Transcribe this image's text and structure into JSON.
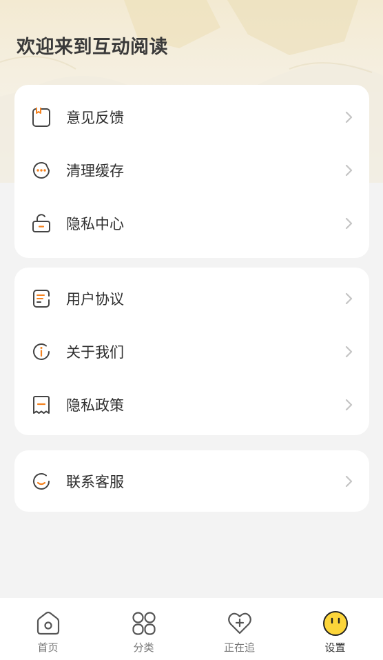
{
  "header": {
    "title": "欢迎来到互动阅读"
  },
  "groups": [
    {
      "items": [
        {
          "label": "意见反馈",
          "icon": "feedback-bookmark-icon"
        },
        {
          "label": "清理缓存",
          "icon": "chat-dots-icon"
        },
        {
          "label": "隐私中心",
          "icon": "lock-icon"
        }
      ]
    },
    {
      "items": [
        {
          "label": "用户协议",
          "icon": "document-icon"
        },
        {
          "label": "关于我们",
          "icon": "info-icon"
        },
        {
          "label": "隐私政策",
          "icon": "receipt-icon"
        }
      ]
    },
    {
      "items": [
        {
          "label": "联系客服",
          "icon": "smile-icon"
        }
      ]
    }
  ],
  "tabbar": {
    "items": [
      {
        "label": "首页",
        "icon": "home-icon",
        "active": false
      },
      {
        "label": "分类",
        "icon": "grid-icon",
        "active": false
      },
      {
        "label": "正在追",
        "icon": "heart-plus-icon",
        "active": false
      },
      {
        "label": "设置",
        "icon": "face-icon",
        "active": true
      }
    ]
  },
  "colors": {
    "accent": "#f5821f",
    "icon_stroke": "#444444",
    "active_tab": "#fcd53a",
    "background": "#f3f3f3"
  }
}
